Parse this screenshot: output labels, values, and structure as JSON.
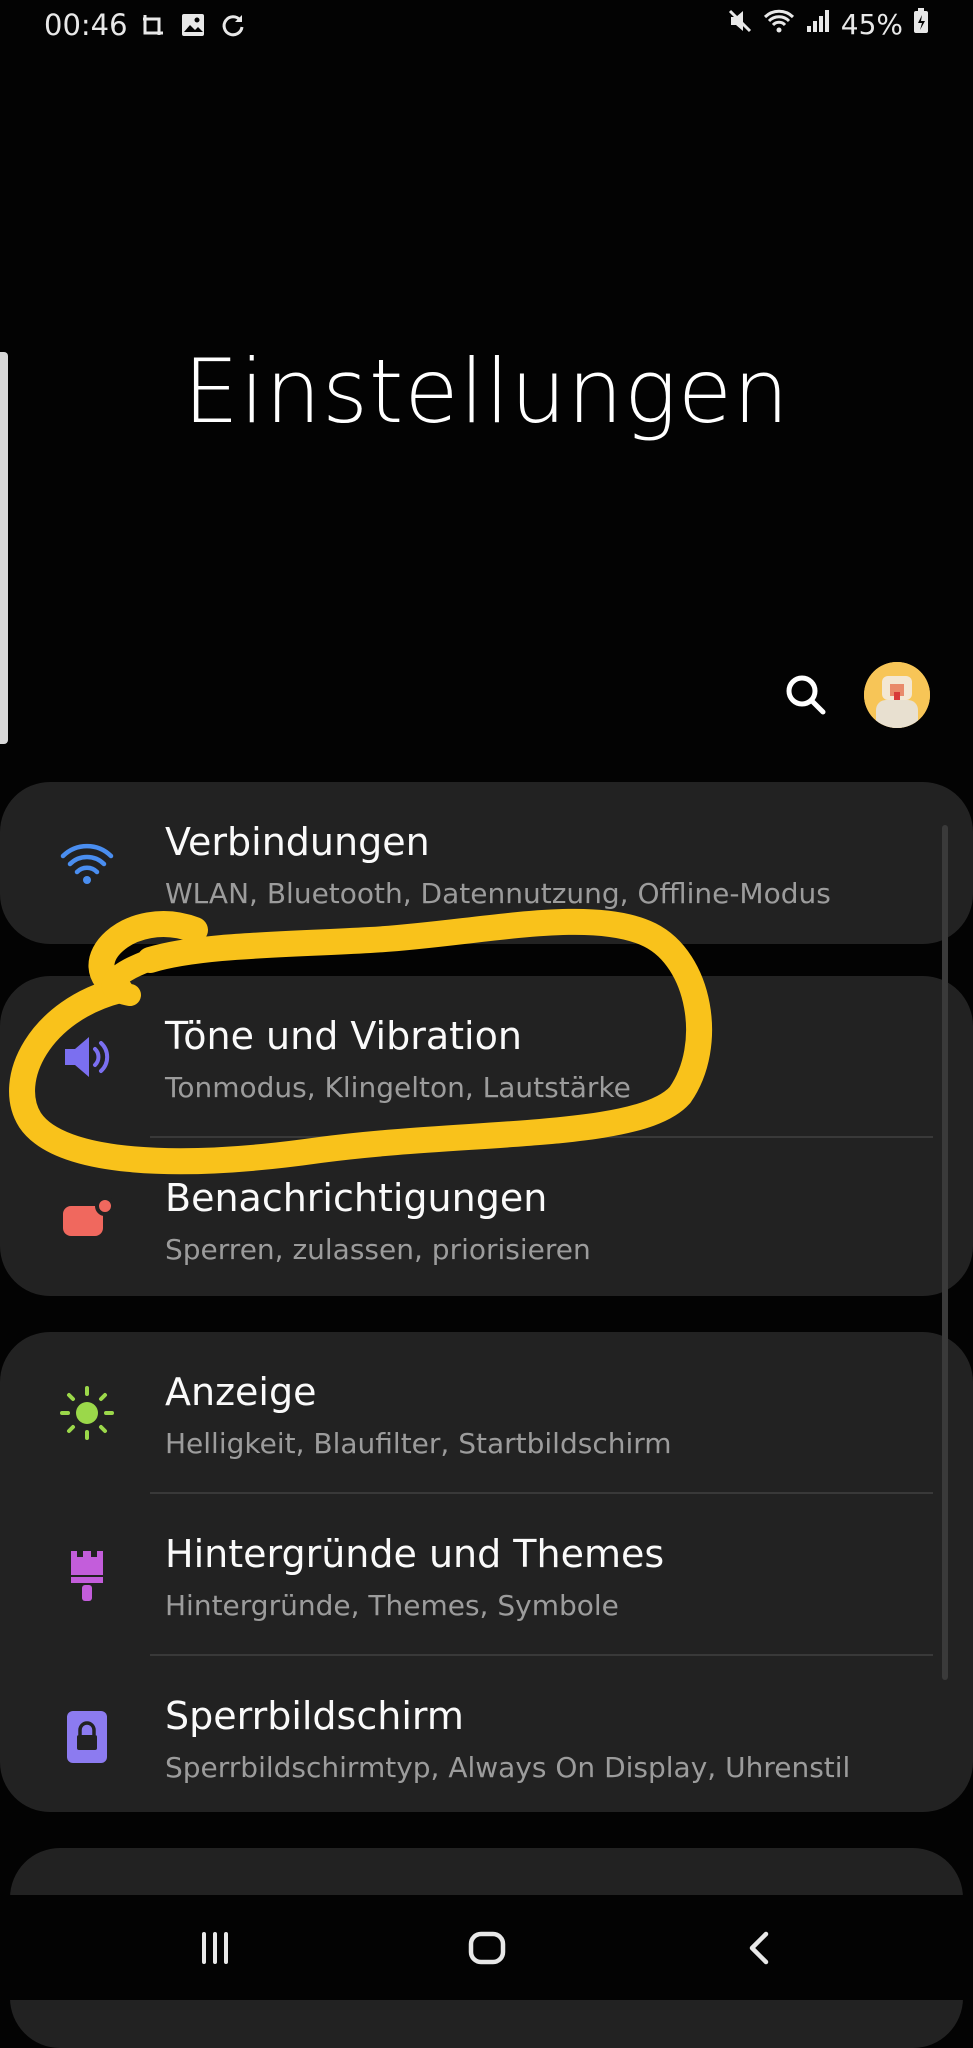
{
  "status_bar": {
    "time": "00:46",
    "battery": "45%",
    "icons_left": [
      "screenshot-icon",
      "gallery-icon",
      "sync-icon"
    ],
    "icons_right": [
      "mute-icon",
      "wifi-icon",
      "signal-icon",
      "battery-charging-icon"
    ]
  },
  "header": {
    "title": "Einstellungen",
    "search_icon": "search-icon",
    "avatar_icon": "profile-avatar"
  },
  "settings": [
    {
      "key": "verbindungen",
      "title": "Verbindungen",
      "subtitle": "WLAN, Bluetooth, Datennutzung, Offline-Modus",
      "icon": "wifi-icon",
      "color": "#4a8ef0"
    },
    {
      "key": "toene",
      "title": "Töne und Vibration",
      "subtitle": "Tonmodus, Klingelton, Lautstärke",
      "icon": "speaker-icon",
      "color": "#7b6ff0"
    },
    {
      "key": "benachrichtigungen",
      "title": "Benachrichtigungen",
      "subtitle": "Sperren, zulassen, priorisieren",
      "icon": "notification-icon",
      "color": "#f0685e"
    },
    {
      "key": "anzeige",
      "title": "Anzeige",
      "subtitle": "Helligkeit, Blaufilter, Startbildschirm",
      "icon": "brightness-icon",
      "color": "#9bd84a"
    },
    {
      "key": "hintergruende",
      "title": "Hintergründe und Themes",
      "subtitle": "Hintergründe, Themes, Symbole",
      "icon": "brush-icon",
      "color": "#c35ddb"
    },
    {
      "key": "sperrbildschirm",
      "title": "Sperrbildschirm",
      "subtitle": "Sperrbildschirmtyp, Always On Display, Uhrenstil",
      "icon": "lock-icon",
      "color": "#8c7bf0"
    }
  ],
  "nav_bar": {
    "recents_icon": "recents-icon",
    "home_icon": "home-icon",
    "back_icon": "back-icon"
  },
  "colors": {
    "background": "#030303",
    "card": "#222222",
    "annotation": "#f9c21b"
  }
}
